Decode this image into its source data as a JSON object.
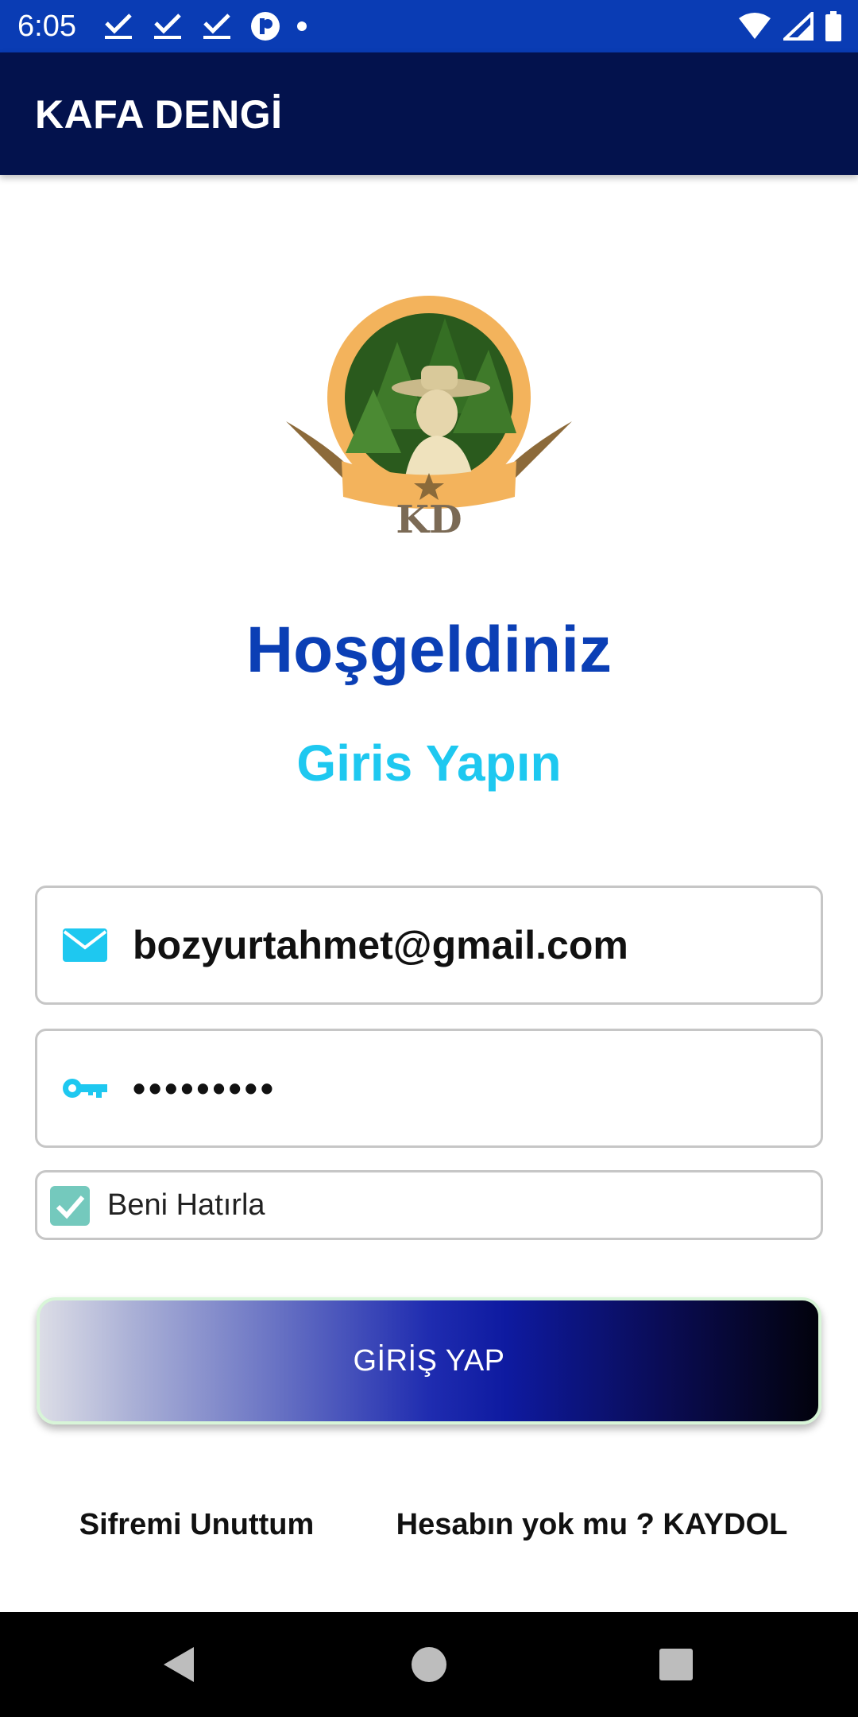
{
  "status_bar": {
    "time": "6:05",
    "notification_icons": [
      "check-icon",
      "check-icon",
      "check-icon",
      "app-icon",
      "dot-icon"
    ],
    "system_icons": [
      "wifi-icon",
      "signal-icon",
      "battery-icon"
    ]
  },
  "app_bar": {
    "title": "KAFA DENGİ"
  },
  "logo": {
    "text": "KD"
  },
  "welcome": {
    "title": "Hoşgeldiniz",
    "subtitle": "Giris Yapın"
  },
  "form": {
    "email_value": "bozyurtahmet@gmail.com",
    "password_value": "•••••••••",
    "remember_label": "Beni Hatırla",
    "remember_checked": true,
    "login_label": "GİRİŞ YAP"
  },
  "links": {
    "forgot": "Sifremi Unuttum",
    "signup": "Hesabın yok mu ? KAYDOL"
  },
  "colors": {
    "status_bar": "#0a3cb4",
    "app_bar": "#03124d",
    "welcome_title": "#0b3fb5",
    "subtitle": "#1ec8f0",
    "field_icon": "#1ec8f0",
    "checkbox": "#74c9bd"
  }
}
